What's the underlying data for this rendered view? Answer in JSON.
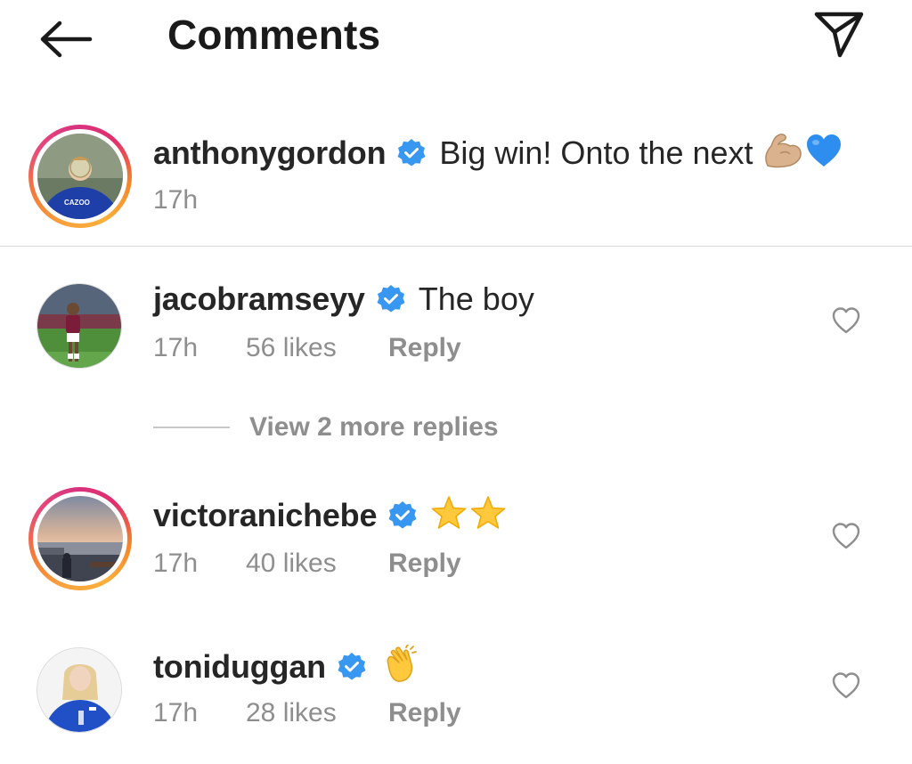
{
  "header": {
    "title": "Comments",
    "back_icon": "arrow-left-icon",
    "send_icon": "paper-plane-icon"
  },
  "colors": {
    "verified_blue": "#3897f0",
    "meta_gray": "#8e8e8e",
    "text": "#262626",
    "divider": "#dbdbdb"
  },
  "caption": {
    "username": "anthonygordon",
    "verified": true,
    "text": "Big win! Onto the next",
    "emojis": [
      "flexed-biceps",
      "blue-heart"
    ],
    "time": "17h",
    "story_ring": true
  },
  "comments": [
    {
      "username": "jacobramseyy",
      "verified": true,
      "text": "The boy",
      "time": "17h",
      "likes": "56 likes",
      "reply": "Reply",
      "story_ring": false
    },
    {
      "username": "victoranichebe",
      "verified": true,
      "text": "",
      "emojis": [
        "star",
        "star"
      ],
      "time": "17h",
      "likes": "40 likes",
      "reply": "Reply",
      "story_ring": true
    },
    {
      "username": "toniduggan",
      "verified": true,
      "text": "",
      "emojis": [
        "clapping-hands"
      ],
      "time": "17h",
      "likes": "28 likes",
      "reply": "Reply",
      "story_ring": false
    }
  ],
  "view_replies": {
    "label": "View 2 more replies"
  }
}
